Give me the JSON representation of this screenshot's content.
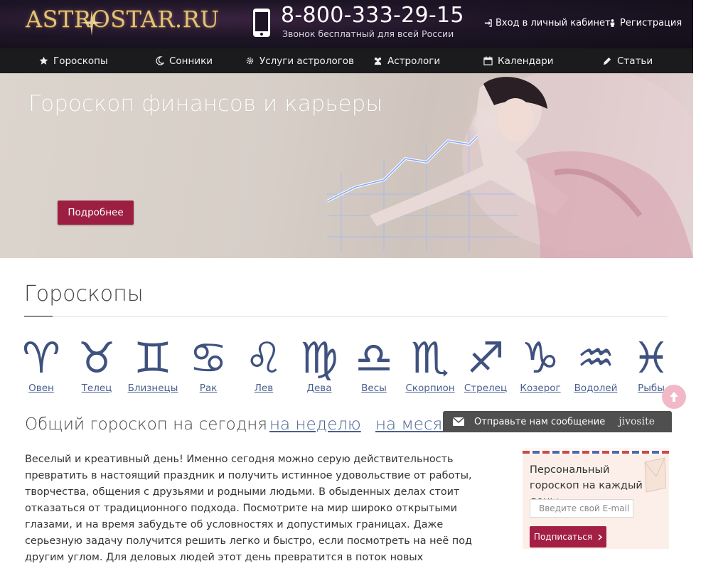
{
  "header": {
    "logo": "ASTROSTAR.RU",
    "phone": "8-800-333-29-15",
    "phone_note": "Звонок бесплатный для всей России",
    "login": "Вход в личный кабинет",
    "register": "Регистрация"
  },
  "nav": [
    {
      "label": "Гороскопы",
      "icon": "star-icon"
    },
    {
      "label": "Сонники",
      "icon": "moon-icon"
    },
    {
      "label": "Услуги астрологов",
      "icon": "gear-icon"
    },
    {
      "label": "Астрологи",
      "icon": "users-icon"
    },
    {
      "label": "Календари",
      "icon": "calendar-icon"
    },
    {
      "label": "Статьи",
      "icon": "pencil-icon"
    }
  ],
  "hero": {
    "title": "Гороскоп финансов и карьеры",
    "button": "Подробнее"
  },
  "horoscopes": {
    "title": "Гороскопы",
    "signs": [
      {
        "glyph": "♈",
        "label": "Овен"
      },
      {
        "glyph": "♉",
        "label": "Телец"
      },
      {
        "glyph": "♊",
        "label": "Близнецы"
      },
      {
        "glyph": "♋",
        "label": "Рак"
      },
      {
        "glyph": "♌",
        "label": "Лев"
      },
      {
        "glyph": "♍",
        "label": "Дева"
      },
      {
        "glyph": "♎",
        "label": "Весы"
      },
      {
        "glyph": "♏",
        "label": "Скорпион"
      },
      {
        "glyph": "♐",
        "label": "Стрелец"
      },
      {
        "glyph": "♑",
        "label": "Козерог"
      },
      {
        "glyph": "♒",
        "label": "Водолей"
      },
      {
        "glyph": "♓",
        "label": "Рыбы"
      }
    ]
  },
  "tabs": {
    "today": "Общий гороскоп на сегодня",
    "week": "на неделю",
    "month": "на месяц"
  },
  "jivo": {
    "text": "Отправьте нам сообщение",
    "brand": "jivosite"
  },
  "forecast": {
    "text": "Веселый и креативный день! Именно сегодня можно серую действительность превратить в настоящий праздник и получить истинное удовольствие от работы, творчества, общения с друзьями и родными людьми. В обыденных делах стоит отказаться от традиционного подхода. Посмотрите на мир широко открытыми глазами, и на время забудьте об условностях и допустимых границах. Даже серьезную задачу получится решить легко и быстро, если посмотреть на неё под другим углом. Для деловых людей этот день превратится в поток новых"
  },
  "subscribe": {
    "title": "Персональный гороскоп на каждый день:",
    "placeholder": "Введите свой E-mail",
    "button": "Подписаться"
  },
  "colors": {
    "accent": "#9c1f41",
    "link": "#4a5f8f",
    "zodiac": "#3f527f",
    "nav_bg": "#1b1a1d"
  }
}
